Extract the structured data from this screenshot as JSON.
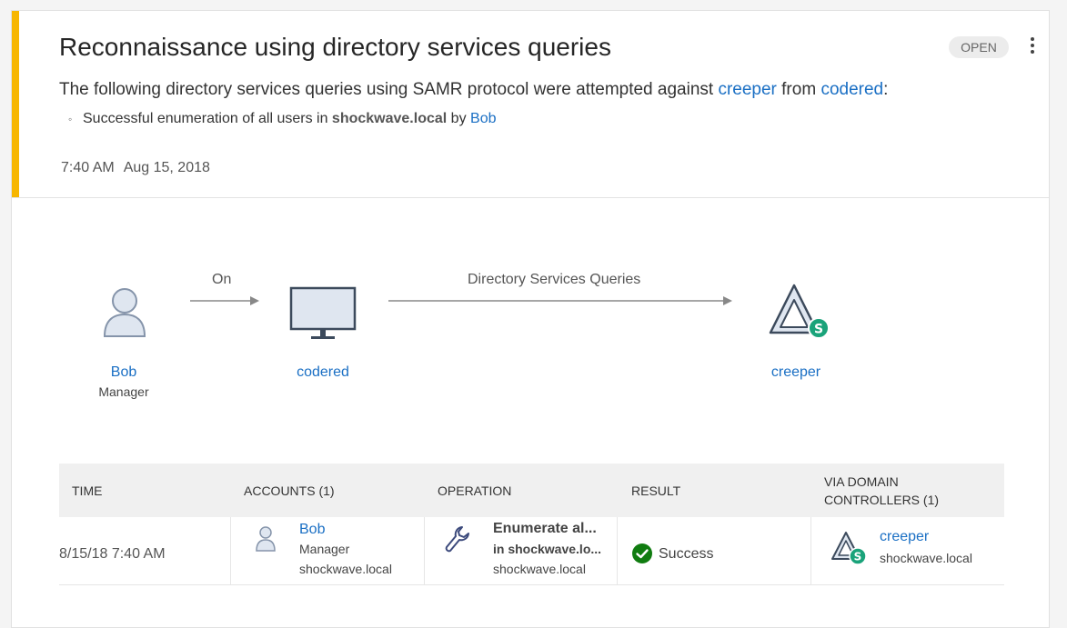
{
  "alert": {
    "title": "Reconnaissance using directory services queries",
    "status": "OPEN",
    "description": {
      "prefix": "The following directory services queries using SAMR protocol were attempted against ",
      "target": "creeper",
      "middle": " from ",
      "source": "codered",
      "suffix": ":"
    },
    "bullet": {
      "prefix": "Successful enumeration of all users in ",
      "domain": "shockwave.local",
      "middle": " by ",
      "user": "Bob"
    },
    "time": "7:40 AM",
    "date": "Aug 15, 2018",
    "accent_color": "#f7b600",
    "link_color": "#1a6fc4"
  },
  "flow": {
    "user": {
      "name": "Bob",
      "role": "Manager",
      "icon": "user-icon"
    },
    "edge1_label": "On",
    "computer": {
      "name": "codered",
      "icon": "monitor-icon"
    },
    "edge2_label": "Directory Services Queries",
    "dc": {
      "name": "creeper",
      "icon": "domain-controller-icon",
      "badge": "S"
    }
  },
  "table": {
    "headers": {
      "time": "TIME",
      "accounts": "ACCOUNTS (1)",
      "operation": "OPERATION",
      "result": "RESULT",
      "via_line1": "VIA DOMAIN",
      "via_line2": "CONTROLLERS (1)"
    },
    "rows": [
      {
        "time": "8/15/18 7:40 AM",
        "account_name": "Bob",
        "account_role": "Manager",
        "account_domain": "shockwave.local",
        "operation_title": "Enumerate al...",
        "operation_sub": "in shockwave.lo...",
        "operation_domain": "shockwave.local",
        "result": "Success",
        "dc_name": "creeper",
        "dc_domain": "shockwave.local"
      }
    ]
  }
}
